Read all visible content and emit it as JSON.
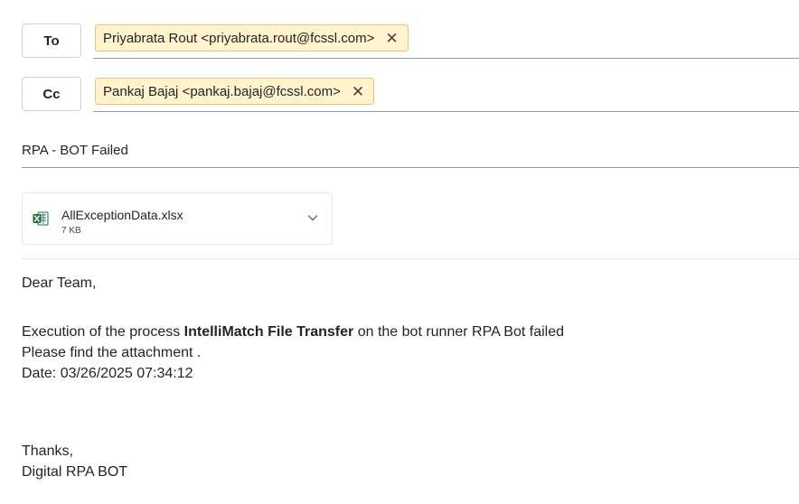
{
  "recipients": {
    "to_label": "To",
    "to_chip": "Priyabrata Rout <priyabrata.rout@fcssl.com>",
    "cc_label": "Cc",
    "cc_chip": "Pankaj Bajaj <pankaj.bajaj@fcssl.com>",
    "remove_glyph": "✕"
  },
  "subject": "RPA - BOT Failed",
  "attachment": {
    "name": "AllExceptionData.xlsx",
    "size": "7 KB",
    "icon": "excel-file-icon"
  },
  "message": {
    "greeting": "Dear Team,",
    "line1_prefix": "Execution of the process ",
    "line1_process": "IntelliMatch File Transfer",
    "line1_suffix": " on the bot runner RPA Bot failed",
    "line2": "Please find the attachment .",
    "line3": "Date: 03/26/2025 07:34:12",
    "signoff": "Thanks,",
    "signature": "Digital RPA BOT"
  },
  "colors": {
    "chip_bg": "#fff4ce",
    "chip_border": "#e3c66d",
    "excel_green": "#1e7145"
  }
}
